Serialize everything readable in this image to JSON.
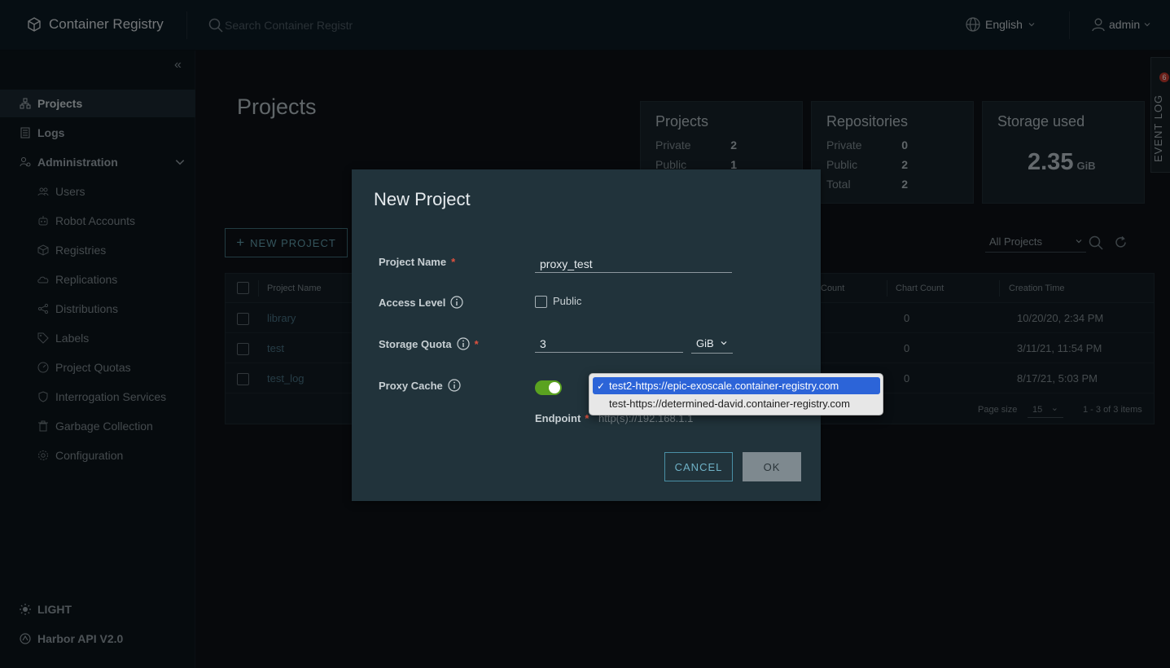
{
  "header": {
    "app_title": "Container Registry",
    "search_placeholder": "Search Container Registr",
    "language": "English",
    "user": "admin"
  },
  "sidebar": {
    "items": [
      {
        "label": "Projects"
      },
      {
        "label": "Logs"
      },
      {
        "label": "Administration"
      },
      {
        "label": "Users"
      },
      {
        "label": "Robot Accounts"
      },
      {
        "label": "Registries"
      },
      {
        "label": "Replications"
      },
      {
        "label": "Distributions"
      },
      {
        "label": "Labels"
      },
      {
        "label": "Project Quotas"
      },
      {
        "label": "Interrogation Services"
      },
      {
        "label": "Garbage Collection"
      },
      {
        "label": "Configuration"
      }
    ],
    "theme_toggle": "LIGHT",
    "api_link": "Harbor API V2.0"
  },
  "main": {
    "page_title": "Projects",
    "cards": {
      "projects": {
        "title": "Projects",
        "private_label": "Private",
        "private": "2",
        "public_label": "Public",
        "public": "1"
      },
      "repositories": {
        "title": "Repositories",
        "private_label": "Private",
        "private": "0",
        "public_label": "Public",
        "public": "2",
        "total_label": "Total",
        "total": "2"
      },
      "storage": {
        "title": "Storage used",
        "value": "2.35",
        "unit": "GiB"
      }
    },
    "new_project_label": "NEW PROJECT",
    "filter_value": "All Projects",
    "table": {
      "headers": {
        "name": "Project Name",
        "count": "Count",
        "chart_count": "Chart Count",
        "creation_time": "Creation Time"
      },
      "rows": [
        {
          "name": "library",
          "chart_count": "0",
          "creation_time": "10/20/20, 2:34 PM"
        },
        {
          "name": "test",
          "chart_count": "0",
          "creation_time": "3/11/21, 11:54 PM"
        },
        {
          "name": "test_log",
          "chart_count": "0",
          "creation_time": "8/17/21, 5:03 PM"
        }
      ],
      "footer": {
        "page_size_label": "Page size",
        "page_size": "15",
        "range": "1 - 3 of 3 items"
      }
    },
    "event_log": {
      "label": "EVENT LOG",
      "badge": "6"
    }
  },
  "modal": {
    "title": "New Project",
    "project_name_label": "Project Name",
    "project_name_value": "proxy_test",
    "access_level_label": "Access Level",
    "public_label": "Public",
    "storage_quota_label": "Storage Quota",
    "storage_quota_value": "3",
    "storage_unit": "GiB",
    "proxy_cache_label": "Proxy Cache",
    "endpoint_label": "Endpoint",
    "endpoint_placeholder": "http(s)://192.168.1.1",
    "cancel_label": "CANCEL",
    "ok_label": "OK",
    "required_mark": "*"
  },
  "dropdown": {
    "check": "✓",
    "options": [
      {
        "label": "test2-https://epic-exoscale.container-registry.com"
      },
      {
        "label": "test-https://determined-david.container-registry.com"
      }
    ]
  },
  "colors": {
    "accent": "#4a90a6",
    "toggle_on": "#5aa220",
    "required": "#e0523f",
    "selection": "#2c64d8"
  }
}
